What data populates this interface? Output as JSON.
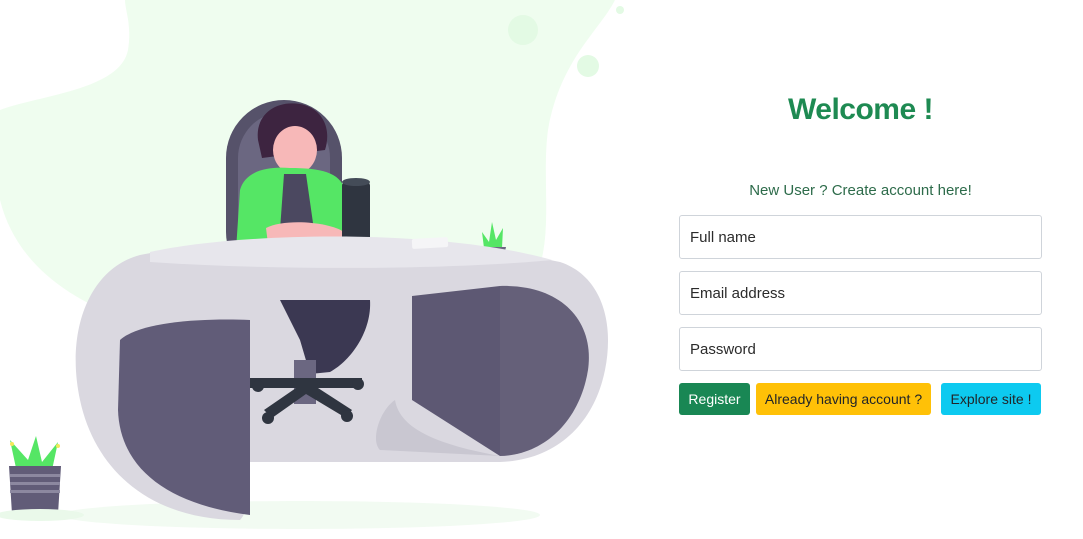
{
  "form": {
    "title": "Welcome !",
    "subtitle": "New User ? Create account here!",
    "fields": {
      "full_name_placeholder": "Full name",
      "email_placeholder": "Email address",
      "password_placeholder": "Password"
    },
    "buttons": {
      "register": "Register",
      "login": "Already having account ?",
      "explore": "Explore site !"
    }
  },
  "colors": {
    "title": "#1e8a52",
    "register": "#198754",
    "login": "#ffc107",
    "explore": "#0dcaf0",
    "blob": "#effdef"
  },
  "illustration": {
    "icon": "person-at-desk-illustration"
  }
}
